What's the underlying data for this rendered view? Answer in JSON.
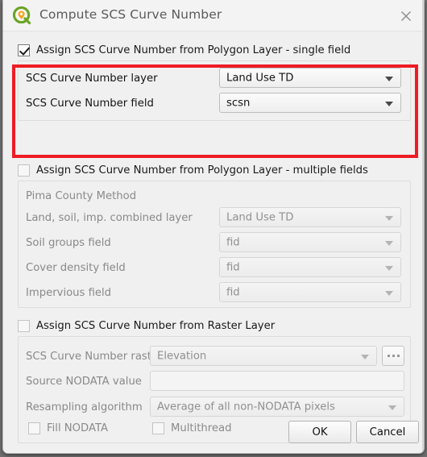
{
  "window": {
    "title": "Compute SCS Curve Number",
    "logo_icon": "qgis-logo-icon",
    "close_icon": "close-icon"
  },
  "highlight": {
    "color": "#ee1c25"
  },
  "sections": [
    {
      "id": "polygon-single-field",
      "checkbox_label": "Assign SCS Curve Number from Polygon Layer - single field",
      "checked": true,
      "enabled": true,
      "highlighted": true,
      "rows": [
        {
          "label": "SCS Curve Number layer",
          "value": "Land Use TD",
          "control": "combobox"
        },
        {
          "label": "SCS Curve Number field",
          "value": "scsn",
          "control": "combobox"
        }
      ]
    },
    {
      "id": "polygon-multiple-fields",
      "checkbox_label": "Assign SCS Curve Number from Polygon Layer - multiple fields",
      "checked": false,
      "enabled": false,
      "highlighted": false,
      "subtitle": "Pima County Method",
      "rows": [
        {
          "label": "Land, soil, imp. combined layer",
          "value": "Land Use TD",
          "control": "combobox"
        },
        {
          "label": "Soil groups field",
          "value": "fid",
          "control": "combobox"
        },
        {
          "label": "Cover density field",
          "value": "fid",
          "control": "combobox"
        },
        {
          "label": "Impervious field",
          "value": "fid",
          "control": "combobox"
        }
      ]
    },
    {
      "id": "raster-layer",
      "checkbox_label": "Assign SCS Curve Number from Raster Layer",
      "checked": false,
      "enabled": false,
      "highlighted": false,
      "rows": [
        {
          "label": "SCS Curve Number raster",
          "value": "Elevation",
          "control": "combobox",
          "browse_label": "..."
        },
        {
          "label": "Source NODATA value",
          "value": "",
          "control": "textinput"
        },
        {
          "label": "Resampling algorithm",
          "value": "Average of all non-NODATA pixels",
          "control": "combobox"
        }
      ],
      "inline_checkboxes": [
        {
          "label": "Fill NODATA",
          "checked": false
        },
        {
          "label": "Multithread",
          "checked": false
        }
      ]
    }
  ],
  "footer": {
    "ok_label": "OK",
    "cancel_label": "Cancel"
  }
}
